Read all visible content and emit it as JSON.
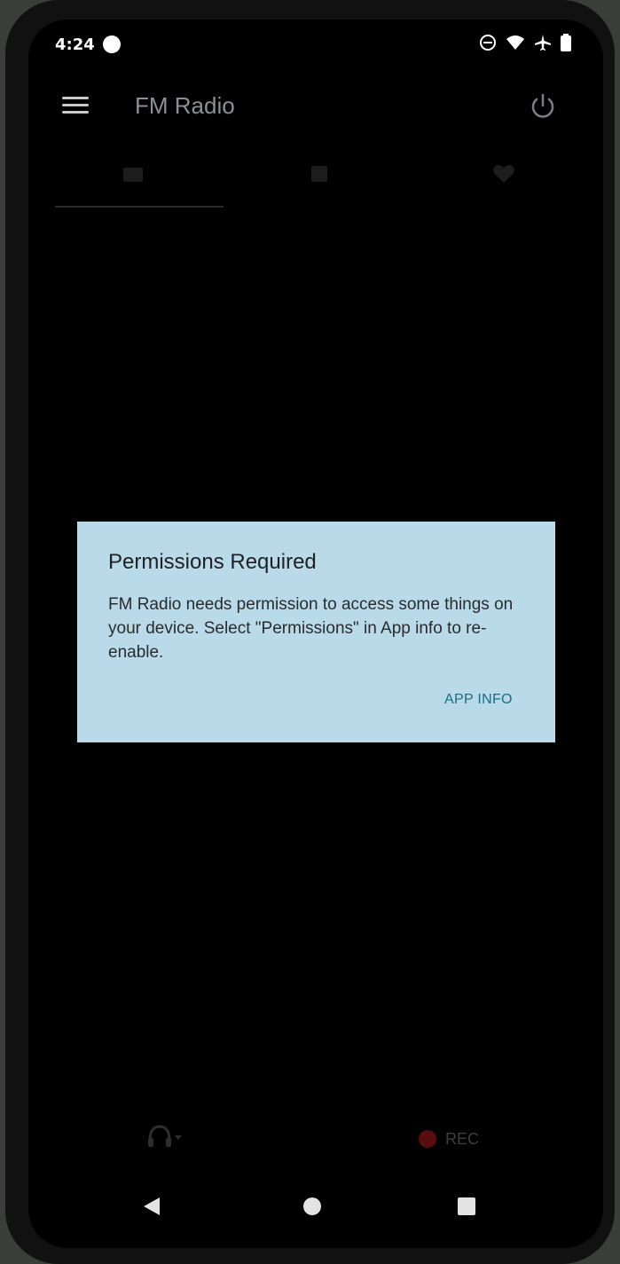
{
  "status_bar": {
    "time": "4:24",
    "icons": [
      "dnd-icon",
      "wifi-icon",
      "airplane-icon",
      "battery-icon"
    ]
  },
  "app_bar": {
    "title": "FM Radio"
  },
  "tabs": [
    "radio-tab-icon",
    "stations-tab-icon",
    "favorites-tab-icon"
  ],
  "dialog": {
    "title": "Permissions Required",
    "body": "FM Radio needs permission to access some things on your device. Select \"Permissions\" in App info to re-enable.",
    "button": "APP INFO"
  },
  "controls": {
    "rec_label": "REC"
  },
  "colors": {
    "dialog_bg": "#b9dbe9",
    "accent": "#1c6b82",
    "screen_bg": "#000000"
  }
}
